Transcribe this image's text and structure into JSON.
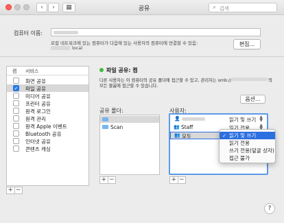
{
  "window": {
    "title": "공유"
  },
  "toolbar": {
    "back_glyph": "‹",
    "forward_glyph": "›",
    "grid_glyph": "▦",
    "search_placeholder": "검색"
  },
  "computer_name": {
    "label": "컴퓨터 이름:",
    "hint": "로컬 네트워크에 있는 컴퓨터가 다음에 있는 사용자의 컴퓨터에 연결할 수 있음:",
    "local_suffix": "local",
    "edit_button": "편집..."
  },
  "services": {
    "header_on": "켬",
    "header_name": "서비스",
    "items": [
      {
        "label": "화면 공유",
        "checked": false
      },
      {
        "label": "파일 공유",
        "checked": true
      },
      {
        "label": "미디어 공유",
        "checked": false
      },
      {
        "label": "프린터 공유",
        "checked": false
      },
      {
        "label": "원격 로그인",
        "checked": false
      },
      {
        "label": "원격 관리",
        "checked": false
      },
      {
        "label": "원격 Apple 이벤트",
        "checked": false
      },
      {
        "label": "Bluetooth 공유",
        "checked": false
      },
      {
        "label": "인터넷 공유",
        "checked": false
      },
      {
        "label": "콘텐츠 캐싱",
        "checked": false
      }
    ]
  },
  "file_sharing": {
    "status": "파일 공유: 켬",
    "status_color": "#3dbb3d",
    "desc_line1_a": "다른 사용자는 이 컴퓨터의 공유 폴더에 접근할 수 있고, 관리자는 smb://",
    "desc_line1_b": "의",
    "desc_line2": "모든 볼륨에 접근할 수 있습니다.",
    "options_button": "옵션...",
    "folders_label": "공유 폴더:",
    "users_label": "사용자:",
    "folders": [
      "",
      "Scan"
    ],
    "users": [
      {
        "name": "",
        "perm": "읽기 및 쓰기"
      },
      {
        "name": "Staff",
        "perm": "읽기 전용"
      },
      {
        "name": "모두",
        "perm": "읽기 및 쓰기"
      }
    ]
  },
  "permission_menu": {
    "items": [
      "읽기 및 쓰기",
      "읽기 전용",
      "쓰기 전용(덮굴 상자)",
      "접근 불가"
    ],
    "selected_index": 0,
    "check": "✓"
  },
  "controls": {
    "plus": "+",
    "minus": "−",
    "help": "?"
  }
}
